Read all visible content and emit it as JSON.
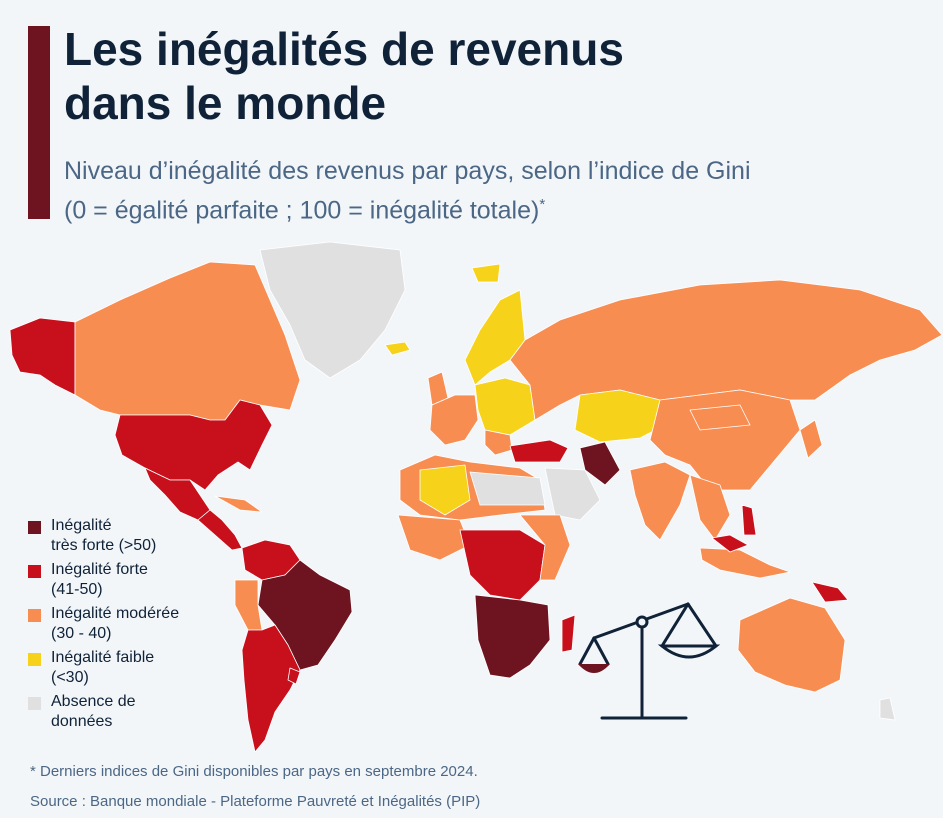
{
  "title_line1": "Les inégalités de revenus",
  "title_line2": "dans le monde",
  "subtitle_line1": "Niveau d’inégalité des revenus par pays, selon l’indice de Gini",
  "subtitle_line2": "(0 = égalité parfaite ; 100 = inégalité totale)",
  "subtitle_mark": "*",
  "legend": [
    {
      "line1": "Inégalité",
      "line2": "très forte (>50)",
      "color": "#6e1420"
    },
    {
      "line1": "Inégalité forte",
      "line2": "(41-50)",
      "color": "#c8101c"
    },
    {
      "line1": "Inégalité modérée",
      "line2": "(30 - 40)",
      "color": "#f88d52"
    },
    {
      "line1": "Inégalité faible",
      "line2": "(<30)",
      "color": "#f7d21a"
    },
    {
      "line1": "Absence de",
      "line2": "données",
      "color": "#e0e0e0"
    }
  ],
  "footnote": "* Derniers indices de Gini disponibles par pays en septembre 2024.",
  "source": "Source : Banque mondiale - Plateforme Pauvreté et Inégalités (PIP)",
  "scale_icon": "balance-scale-icon"
}
